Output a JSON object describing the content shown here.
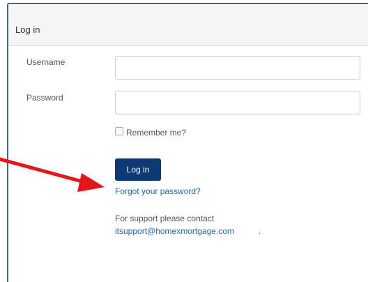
{
  "panel": {
    "title": "Log in"
  },
  "form": {
    "username_label": "Username",
    "username_value": "",
    "password_label": "Password",
    "password_value": "",
    "remember_label": "Remember me?",
    "remember_checked": false,
    "login_button": "Log in",
    "forgot_link": "Forgot your password?",
    "support_text": "For support please contact",
    "support_email": "itsupport@homexmortgage.com",
    "support_suffix": "."
  },
  "annotation": {
    "arrow_color": "#e8141c",
    "icon": "red-arrow-icon"
  },
  "colors": {
    "button_bg": "#0b3a75",
    "link": "#1a6aa8",
    "panel_border": "#2e6da4"
  }
}
